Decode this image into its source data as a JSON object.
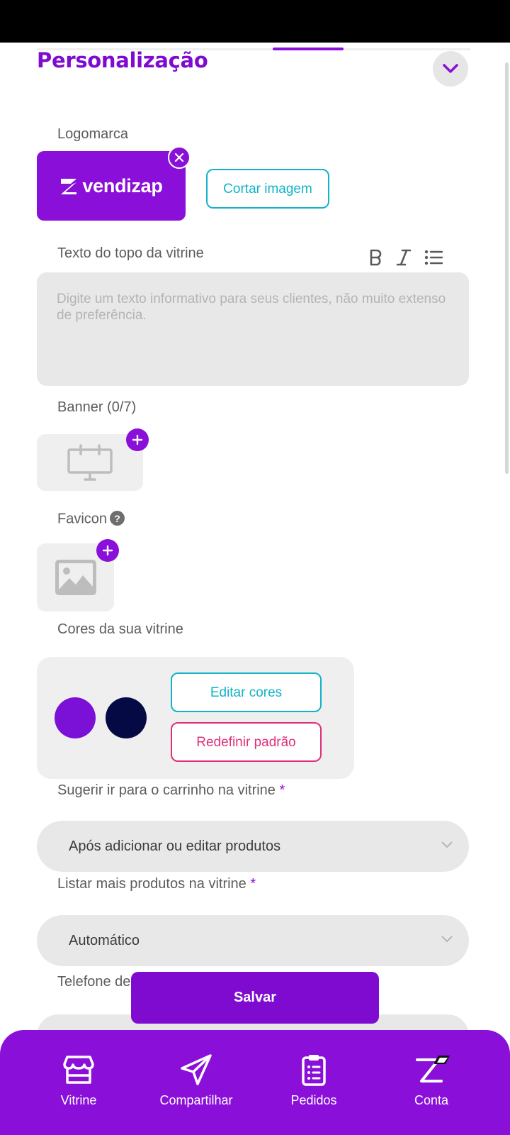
{
  "colors": {
    "brand": "#8a0fd9",
    "accent_cyan": "#12b3c9",
    "accent_pink": "#e0307a",
    "swatch_primary": "#7b10d6",
    "swatch_secondary": "#050a45"
  },
  "section": {
    "title": "Personalização"
  },
  "logo": {
    "label": "Logomarca",
    "brand_text": "vendizap",
    "crop_label": "Cortar imagem"
  },
  "top_text": {
    "label": "Texto do topo da vitrine",
    "placeholder": "Digite um texto informativo para seus clientes, não muito extenso de preferência."
  },
  "banner": {
    "label": "Banner (0/7)"
  },
  "favicon": {
    "label": "Favicon",
    "help": "?"
  },
  "colors_section": {
    "label": "Cores da sua vitrine",
    "edit_label": "Editar cores",
    "reset_label": "Redefinir padrão"
  },
  "cart_suggest": {
    "label": "Sugerir ir para o carrinho na vitrine",
    "required": "*",
    "value": "Após adicionar ou editar produtos"
  },
  "list_more": {
    "label": "Listar mais produtos na vitrine",
    "required": "*",
    "value": "Automático"
  },
  "phone": {
    "label": "Telefone de"
  },
  "save_label": "Salvar",
  "nav": [
    {
      "label": "Vitrine",
      "icon": "store-icon"
    },
    {
      "label": "Compartilhar",
      "icon": "send-icon"
    },
    {
      "label": "Pedidos",
      "icon": "clipboard-icon"
    },
    {
      "label": "Conta",
      "icon": "account-icon"
    }
  ]
}
